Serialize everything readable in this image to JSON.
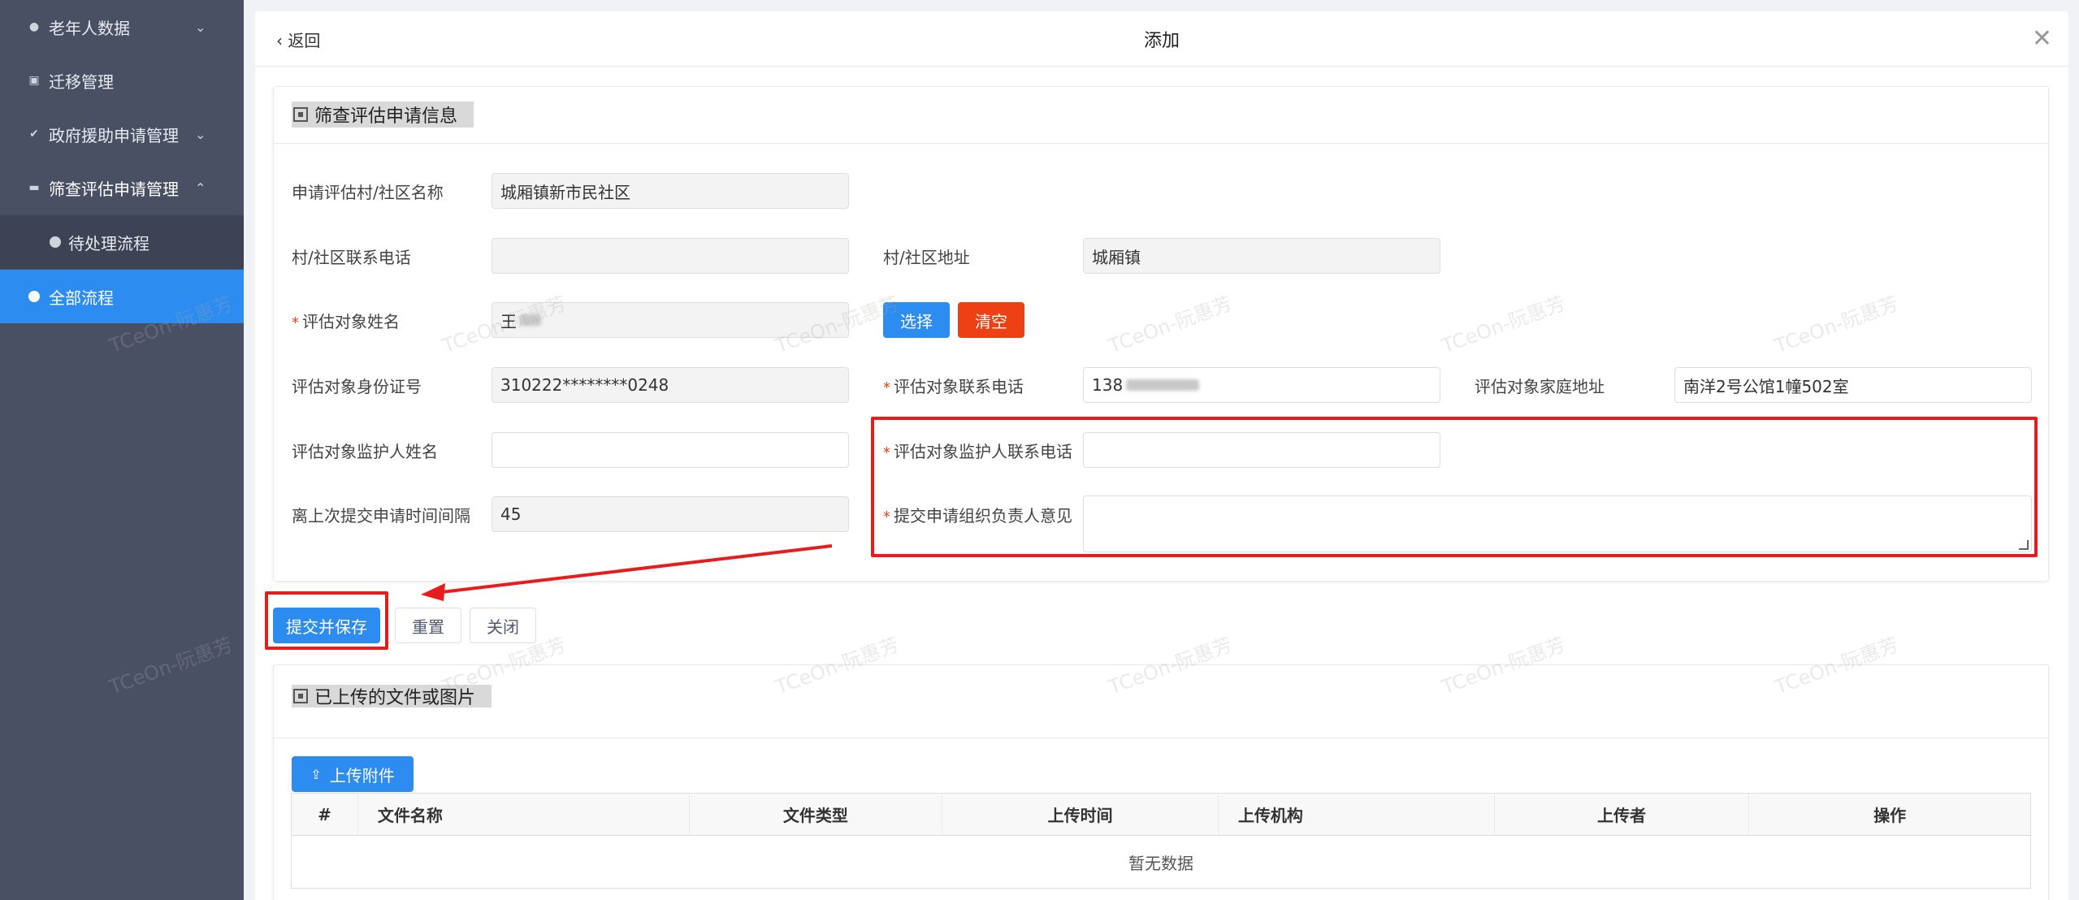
{
  "sidebar": {
    "items": [
      {
        "label": "老年人数据",
        "icon": "user-circle-icon"
      },
      {
        "label": "迁移管理",
        "icon": "chart-icon"
      },
      {
        "label": "政府援助申请管理",
        "icon": "check-circle-icon"
      },
      {
        "label": "筛查评估申请管理",
        "icon": "card-icon"
      },
      {
        "label": "待处理流程",
        "icon": "dot-icon"
      },
      {
        "label": "全部流程",
        "icon": "dot-icon",
        "active": true
      }
    ]
  },
  "modal": {
    "back_label": "返回",
    "title": "添加"
  },
  "form": {
    "section_title": "筛查评估申请信息",
    "village_name_label": "申请评估村/社区名称",
    "village_name_value": "城厢镇新市民社区",
    "village_phone_label": "村/社区联系电话",
    "village_phone_value": "",
    "village_address_label": "村/社区地址",
    "village_address_value": "城厢镇",
    "subject_name_label": "评估对象姓名",
    "subject_name_value": "王",
    "select_button": "选择",
    "clear_button": "清空",
    "id_label": "评估对象身份证号",
    "id_value": "310222********0248",
    "subject_phone_label": "评估对象联系电话",
    "subject_phone_value": "138",
    "home_address_label": "评估对象家庭地址",
    "home_address_value": "南洋2号公馆1幢502室",
    "guardian_name_label": "评估对象监护人姓名",
    "guardian_name_value": "",
    "guardian_phone_label": "评估对象监护人联系电话",
    "guardian_phone_value": "",
    "interval_label": "离上次提交申请时间间隔",
    "interval_value": "45",
    "opinion_label": "提交申请组织负责人意见",
    "opinion_value": ""
  },
  "actions": {
    "submit": "提交并保存",
    "reset": "重置",
    "close": "关闭"
  },
  "files": {
    "section_title": "已上传的文件或图片",
    "upload_button": "上传附件",
    "columns": [
      "#",
      "文件名称",
      "文件类型",
      "上传时间",
      "上传机构",
      "上传者",
      "操作"
    ],
    "empty_text": "暂无数据"
  },
  "watermark_text": "TCeOn-阮惠芳",
  "colors": {
    "primary": "#2d8cf0",
    "danger": "#ed4014",
    "sidebar": "#4a5064",
    "highlight": "#e81c1c"
  }
}
